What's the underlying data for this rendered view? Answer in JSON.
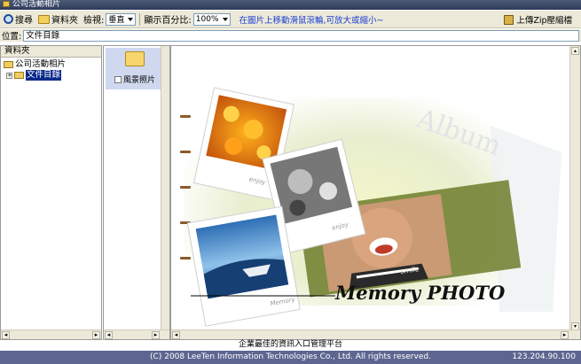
{
  "window": {
    "title": "公司活動相片"
  },
  "toolbar": {
    "search_label": "搜尋",
    "folders_label": "資料夾",
    "view_label": "檢視:",
    "view_value": "垂直",
    "zoom_label": "顯示百分比:",
    "zoom_value": "100%",
    "hint": "在圖片上移動滑鼠滾輪,可放大或縮小~",
    "upload_label": "上傳Zip壓縮檔"
  },
  "location": {
    "label": "位置:",
    "value": "文件目錄"
  },
  "folder_panel": {
    "header": "資料夾",
    "root": "公司活動相片",
    "child": "文件目錄"
  },
  "album": {
    "label": "風景照片"
  },
  "photo": {
    "caption": "Memory PHOTO",
    "small_labels": [
      "enjoy",
      "enjoy",
      "smile",
      "Memory"
    ],
    "watermark": "Album"
  },
  "footer": {
    "tagline": "企業最佳的資訊入口管理平台",
    "copyright": "(C) 2008 LeeTen Information Technologies Co., Ltd. All rights reserved.",
    "ip": "123.204.90.100"
  }
}
